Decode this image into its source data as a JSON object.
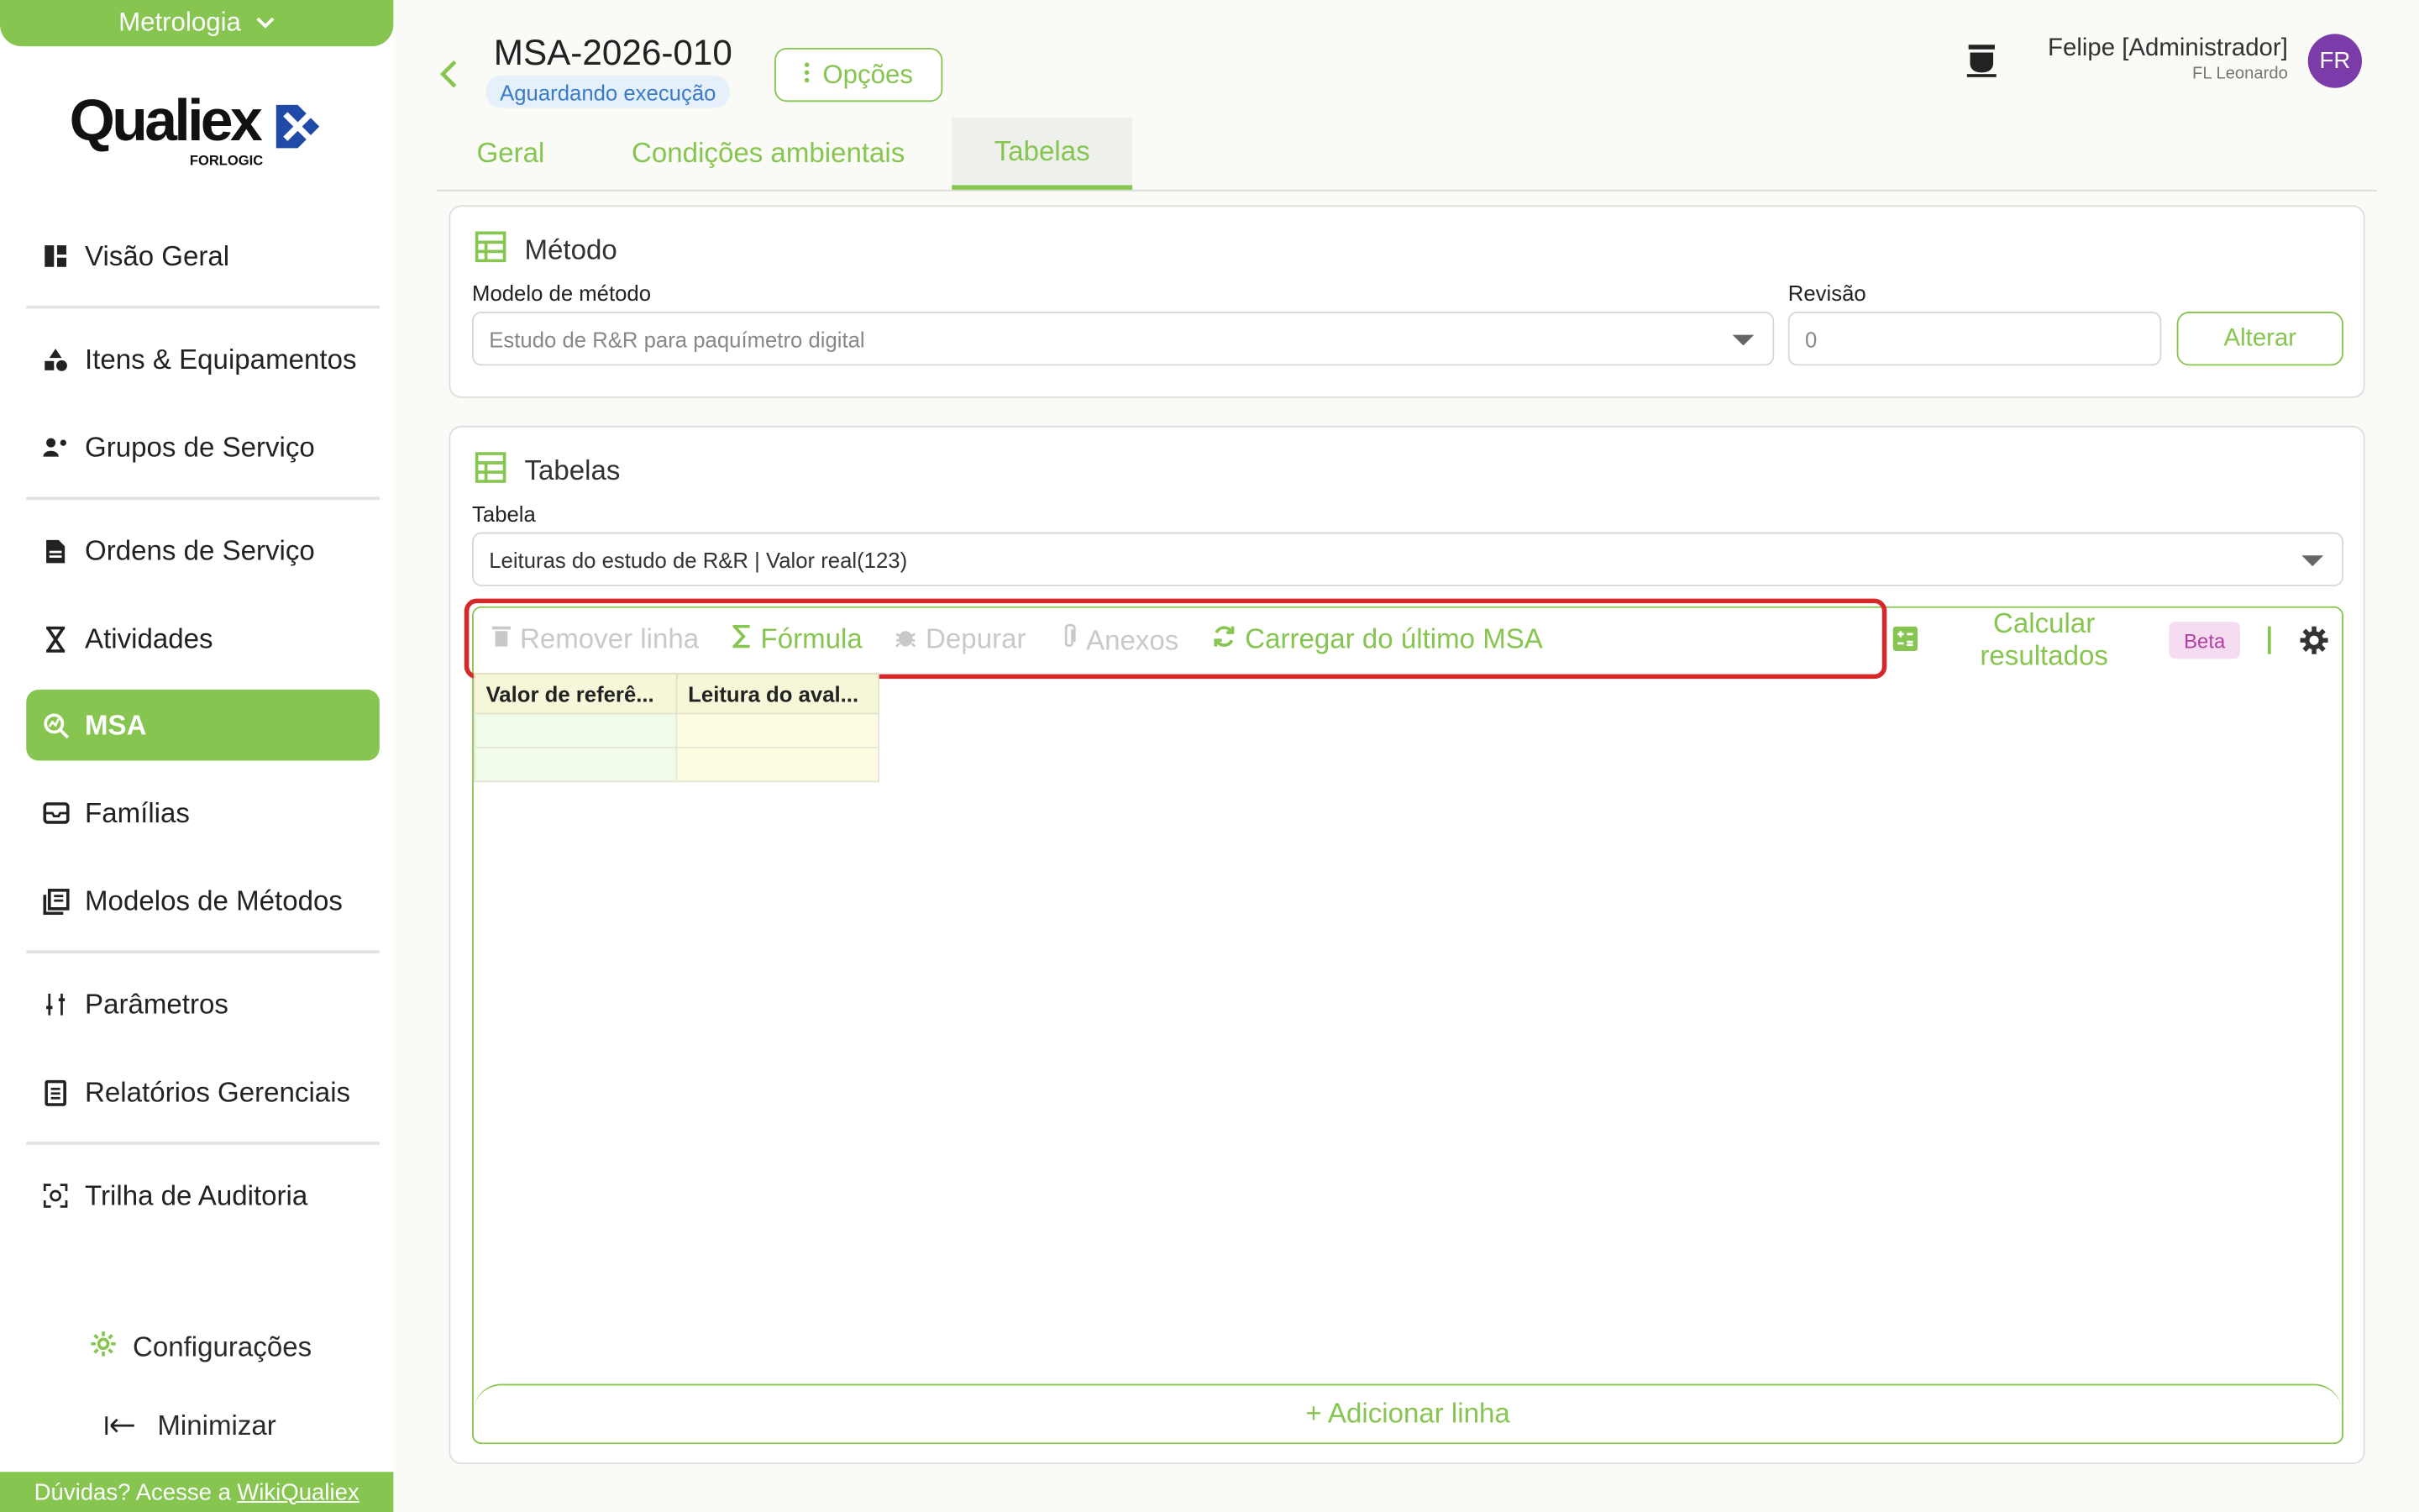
{
  "sidebar": {
    "module": "Metrologia",
    "logo_text": "Qualiex",
    "logo_sub": "FORLOGIC",
    "items": [
      {
        "label": "Visão Geral",
        "icon": "dashboard-icon"
      },
      {
        "label": "Itens & Equipamentos",
        "icon": "shapes-icon"
      },
      {
        "label": "Grupos de Serviço",
        "icon": "group-icon"
      },
      {
        "label": "Ordens de Serviço",
        "icon": "document-icon"
      },
      {
        "label": "Atividades",
        "icon": "hourglass-icon"
      },
      {
        "label": "MSA",
        "icon": "zoom-chart-icon"
      },
      {
        "label": "Famílias",
        "icon": "tray-icon"
      },
      {
        "label": "Modelos de Métodos",
        "icon": "library-icon"
      },
      {
        "label": "Parâmetros",
        "icon": "sliders-icon"
      },
      {
        "label": "Relatórios Gerenciais",
        "icon": "report-icon"
      },
      {
        "label": "Trilha de Auditoria",
        "icon": "audit-icon"
      }
    ],
    "active": "MSA",
    "settings_label": "Configurações",
    "minimize_label": "Minimizar",
    "help_prefix": "Dúvidas? Acesse a",
    "help_link": "WikiQualiex"
  },
  "header": {
    "title": "MSA-2026-010",
    "status": "Aguardando execução",
    "options_label": "Opções",
    "user_name": "Felipe [Administrador]",
    "user_company": "FL Leonardo",
    "avatar_initials": "FR"
  },
  "tabs": [
    {
      "label": "Geral",
      "active": false
    },
    {
      "label": "Condições ambientais",
      "active": false
    },
    {
      "label": "Tabelas",
      "active": true
    }
  ],
  "method": {
    "title": "Método",
    "model_label": "Modelo de método",
    "model_value": "Estudo de R&R para paquímetro digital",
    "revision_label": "Revisão",
    "revision_value": "0",
    "alter_label": "Alterar"
  },
  "tables": {
    "title": "Tabelas",
    "table_label": "Tabela",
    "table_value": "Leituras do estudo de R&R | Valor real(123)",
    "toolbar": {
      "remove_row": "Remover linha",
      "formula": "Fórmula",
      "debug": "Depurar",
      "attachments": "Anexos",
      "load_last": "Carregar do último MSA",
      "calc_line1": "Calcular",
      "calc_line2": "resultados",
      "beta": "Beta"
    },
    "columns": [
      "Valor de referê...",
      "Leitura do aval..."
    ],
    "add_row_label": "+ Adicionar linha"
  },
  "colors": {
    "accent": "#86c54f",
    "highlight": "#d62828",
    "avatar": "#7b3ba8",
    "status_bg": "#e6f0fb",
    "status_text": "#3a7bc8"
  }
}
